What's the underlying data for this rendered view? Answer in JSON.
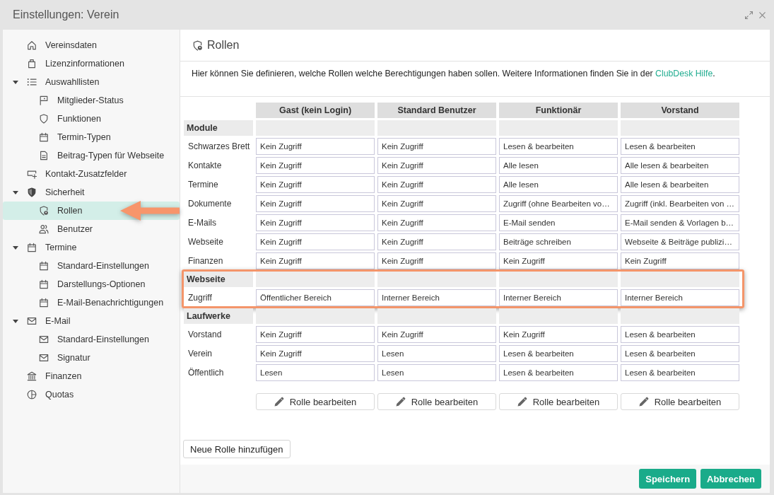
{
  "window": {
    "title": "Einstellungen: Verein"
  },
  "sidebar": {
    "items": [
      {
        "label": "Vereinsdaten",
        "selected": false
      },
      {
        "label": "Lizenzinformationen",
        "selected": false
      },
      {
        "label": "Auswahllisten",
        "selected": false,
        "expanded": true,
        "children": [
          {
            "label": "Mitglieder-Status",
            "selected": false
          },
          {
            "label": "Funktionen",
            "selected": false
          },
          {
            "label": "Termin-Typen",
            "selected": false
          },
          {
            "label": "Beitrag-Typen für Webseite",
            "selected": false
          }
        ]
      },
      {
        "label": "Kontakt-Zusatzfelder",
        "selected": false
      },
      {
        "label": "Sicherheit",
        "selected": false,
        "expanded": true,
        "children": [
          {
            "label": "Rollen",
            "selected": true,
            "callout": true
          },
          {
            "label": "Benutzer",
            "selected": false
          }
        ]
      },
      {
        "label": "Termine",
        "selected": false,
        "expanded": true,
        "children": [
          {
            "label": "Standard-Einstellungen",
            "selected": false
          },
          {
            "label": "Darstellungs-Optionen",
            "selected": false
          },
          {
            "label": "E-Mail-Benachrichtigungen",
            "selected": false
          }
        ]
      },
      {
        "label": "E-Mail",
        "selected": false,
        "expanded": true,
        "children": [
          {
            "label": "Standard-Einstellungen",
            "selected": false
          },
          {
            "label": "Signatur",
            "selected": false
          }
        ]
      },
      {
        "label": "Finanzen",
        "selected": false
      },
      {
        "label": "Quotas",
        "selected": false
      }
    ]
  },
  "panel": {
    "title": "Rollen",
    "intro": {
      "text": "Hier können Sie definieren, welche Rollen welche Berechtigungen haben sollen. Weitere Informationen finden Sie in der ",
      "link": "ClubDesk Hilfe",
      "after": "."
    }
  },
  "table": {
    "columns": [
      {
        "title": "Gast (kein Login)",
        "button": "Rolle bearbeiten"
      },
      {
        "title": "Standard Benutzer",
        "button": "Rolle bearbeiten"
      },
      {
        "title": "Funktionär",
        "button": "Rolle bearbeiten"
      },
      {
        "title": "Vorstand",
        "button": "Rolle bearbeiten"
      }
    ],
    "sections": [
      {
        "title": "Module",
        "callout": false,
        "rows": [
          {
            "label": "Schwarzes Brett",
            "cells": [
              "Kein Zugriff",
              "Kein Zugriff",
              "Lesen & bearbeiten",
              "Lesen & bearbeiten"
            ]
          },
          {
            "label": "Kontakte",
            "cells": [
              "Kein Zugriff",
              "Kein Zugriff",
              "Alle lesen",
              "Alle lesen & bearbeiten"
            ]
          },
          {
            "label": "Termine",
            "cells": [
              "Kein Zugriff",
              "Kein Zugriff",
              "Alle lesen",
              "Alle lesen & bearbeiten"
            ]
          },
          {
            "label": "Dokumente",
            "cells": [
              "Kein Zugriff",
              "Kein Zugriff",
              "Zugriff (ohne Bearbeiten vo…",
              "Zugriff (inkl. Bearbeiten von …"
            ]
          },
          {
            "label": "E-Mails",
            "cells": [
              "Kein Zugriff",
              "Kein Zugriff",
              "E-Mail senden",
              "E-Mail senden & Vorlagen b…"
            ]
          },
          {
            "label": "Webseite",
            "cells": [
              "Kein Zugriff",
              "Kein Zugriff",
              "Beiträge schreiben",
              "Webseite & Beiträge publizi…"
            ]
          },
          {
            "label": "Finanzen",
            "cells": [
              "Kein Zugriff",
              "Kein Zugriff",
              "Kein Zugriff",
              "Kein Zugriff"
            ]
          }
        ]
      },
      {
        "title": "Webseite",
        "callout": true,
        "rows": [
          {
            "label": "Zugriff",
            "cells": [
              "Öffentlicher Bereich",
              "Interner Bereich",
              "Interner Bereich",
              "Interner Bereich"
            ]
          }
        ]
      },
      {
        "title": "Laufwerke",
        "callout": false,
        "rows": [
          {
            "label": "Vorstand",
            "cells": [
              "Kein Zugriff",
              "Kein Zugriff",
              "Kein Zugriff",
              "Lesen & bearbeiten"
            ]
          },
          {
            "label": "Verein",
            "cells": [
              "Kein Zugriff",
              "Lesen",
              "Lesen & bearbeiten",
              "Lesen & bearbeiten"
            ]
          },
          {
            "label": "Öffentlich",
            "cells": [
              "Lesen",
              "Lesen",
              "Lesen & bearbeiten",
              "Lesen & bearbeiten"
            ]
          }
        ]
      }
    ]
  },
  "add_button": "Neue Rolle hinzufügen",
  "footer": {
    "buttons": [
      "Speichern",
      "Abbrechen"
    ]
  }
}
